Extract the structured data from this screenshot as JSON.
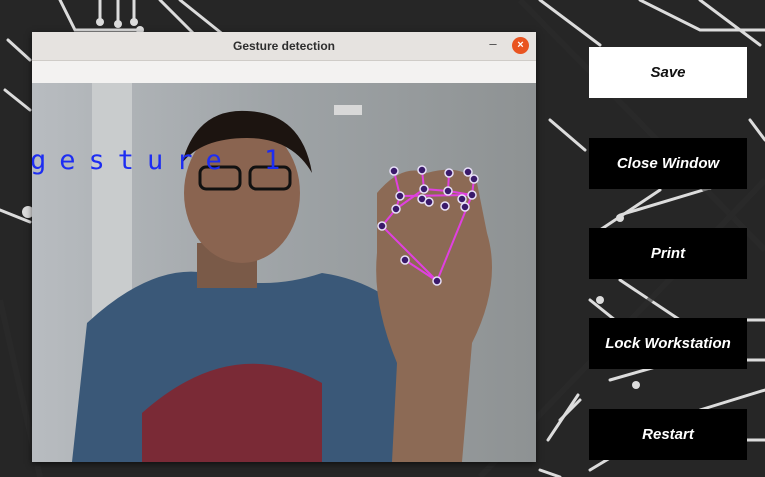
{
  "window": {
    "title": "Gesture detection",
    "minimize_glyph": "–",
    "close_glyph": "×"
  },
  "overlay": {
    "gesture_label": "gesture 1",
    "text_color": "#1d2df2",
    "landmark_color": "#e040e0"
  },
  "buttons": [
    {
      "id": "save",
      "label": "Save",
      "style": "light"
    },
    {
      "id": "close-window",
      "label": "Close Window",
      "style": "dark"
    },
    {
      "id": "print",
      "label": "Print",
      "style": "dark"
    },
    {
      "id": "lock-workstation",
      "label": "Lock Workstation",
      "style": "dark"
    },
    {
      "id": "restart",
      "label": "Restart",
      "style": "dark"
    }
  ],
  "icons": {
    "close": "close-icon",
    "minimize": "minimize-icon"
  },
  "colors": {
    "background": "#262626",
    "close_button": "#e95420",
    "titlebar": "#e6e3e0"
  }
}
